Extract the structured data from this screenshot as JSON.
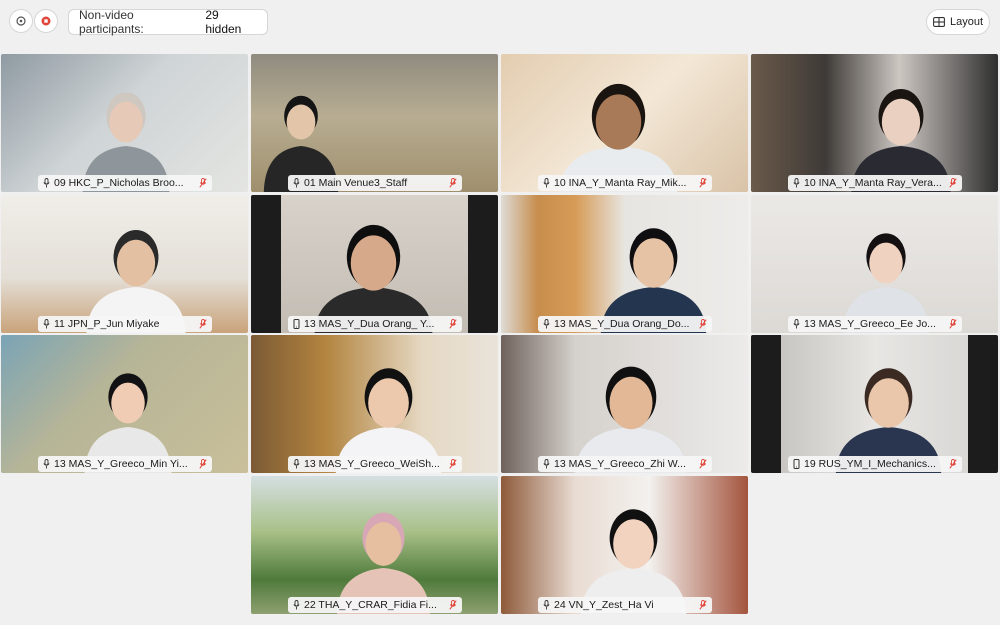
{
  "toolbar": {
    "participants_label": "Non-video participants:",
    "participants_hidden": "29 hidden",
    "layout_label": "Layout",
    "icons": [
      "info-icon",
      "record-icon",
      "layout-grid-icon"
    ],
    "record_color": "#e0453a"
  },
  "participants": [
    {
      "name": "09 HKC_P_Nicholas Broo...",
      "icon": "mic-icon"
    },
    {
      "name": "01 Main Venue3_Staff",
      "icon": "mic-icon"
    },
    {
      "name": "10 INA_Y_Manta Ray_Mik...",
      "icon": "mic-icon"
    },
    {
      "name": "10 INA_Y_Manta Ray_Vera...",
      "icon": "mic-icon"
    },
    {
      "name": "11 JPN_P_Jun Miyake",
      "icon": "mic-icon"
    },
    {
      "name": "13 MAS_Y_Dua Orang_ Y...",
      "icon": "phone-icon"
    },
    {
      "name": "13 MAS_Y_Dua Orang_Do...",
      "icon": "mic-icon"
    },
    {
      "name": "13 MAS_Y_Greeco_Ee Jo...",
      "icon": "mic-icon"
    },
    {
      "name": "13 MAS_Y_Greeco_Min Yi...",
      "icon": "mic-icon"
    },
    {
      "name": "13 MAS_Y_Greeco_WeiSh...",
      "icon": "mic-icon"
    },
    {
      "name": "13 MAS_Y_Greeco_Zhi W...",
      "icon": "mic-icon"
    },
    {
      "name": "19 RUS_YM_I_Mechanics...",
      "icon": "phone-icon"
    },
    {
      "name": "22 THA_Y_CRAR_Fidia Fi...",
      "icon": "mic-icon"
    },
    {
      "name": "24 VN_Y_Zest_Ha Vi",
      "icon": "mic-icon"
    }
  ],
  "muted_icon": "muted-mic-icon",
  "muted_color": "#e0453a"
}
